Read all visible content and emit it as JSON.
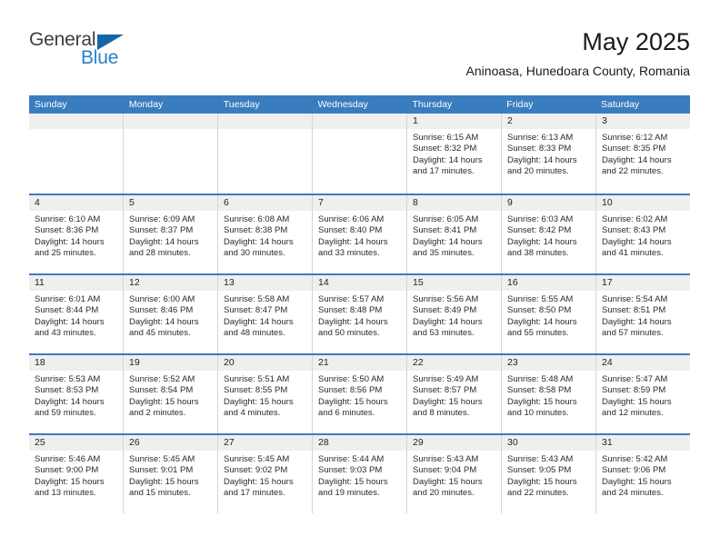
{
  "brand": {
    "name_top": "General",
    "name_bottom": "Blue",
    "triangle_icon": "blue-triangle-icon",
    "color_dark": "#3d3d3d",
    "color_blue": "#2a7fc9"
  },
  "header": {
    "title": "May 2025",
    "subtitle": "Aninoasa, Hunedoara County, Romania"
  },
  "colors": {
    "header_row_bg": "#3a7dbf",
    "header_row_text": "#ffffff",
    "daynum_bg": "#efefef",
    "cell_border": "#d5d5d5",
    "week_divider": "#3a7dbf"
  },
  "weekdays": [
    "Sunday",
    "Monday",
    "Tuesday",
    "Wednesday",
    "Thursday",
    "Friday",
    "Saturday"
  ],
  "weeks": [
    [
      {
        "day": "",
        "empty": true,
        "sunrise": "",
        "sunset": "",
        "daylight1": "",
        "daylight2": ""
      },
      {
        "day": "",
        "empty": true,
        "sunrise": "",
        "sunset": "",
        "daylight1": "",
        "daylight2": ""
      },
      {
        "day": "",
        "empty": true,
        "sunrise": "",
        "sunset": "",
        "daylight1": "",
        "daylight2": ""
      },
      {
        "day": "",
        "empty": true,
        "sunrise": "",
        "sunset": "",
        "daylight1": "",
        "daylight2": ""
      },
      {
        "day": "1",
        "empty": false,
        "sunrise": "Sunrise: 6:15 AM",
        "sunset": "Sunset: 8:32 PM",
        "daylight1": "Daylight: 14 hours",
        "daylight2": "and 17 minutes."
      },
      {
        "day": "2",
        "empty": false,
        "sunrise": "Sunrise: 6:13 AM",
        "sunset": "Sunset: 8:33 PM",
        "daylight1": "Daylight: 14 hours",
        "daylight2": "and 20 minutes."
      },
      {
        "day": "3",
        "empty": false,
        "sunrise": "Sunrise: 6:12 AM",
        "sunset": "Sunset: 8:35 PM",
        "daylight1": "Daylight: 14 hours",
        "daylight2": "and 22 minutes."
      }
    ],
    [
      {
        "day": "4",
        "empty": false,
        "sunrise": "Sunrise: 6:10 AM",
        "sunset": "Sunset: 8:36 PM",
        "daylight1": "Daylight: 14 hours",
        "daylight2": "and 25 minutes."
      },
      {
        "day": "5",
        "empty": false,
        "sunrise": "Sunrise: 6:09 AM",
        "sunset": "Sunset: 8:37 PM",
        "daylight1": "Daylight: 14 hours",
        "daylight2": "and 28 minutes."
      },
      {
        "day": "6",
        "empty": false,
        "sunrise": "Sunrise: 6:08 AM",
        "sunset": "Sunset: 8:38 PM",
        "daylight1": "Daylight: 14 hours",
        "daylight2": "and 30 minutes."
      },
      {
        "day": "7",
        "empty": false,
        "sunrise": "Sunrise: 6:06 AM",
        "sunset": "Sunset: 8:40 PM",
        "daylight1": "Daylight: 14 hours",
        "daylight2": "and 33 minutes."
      },
      {
        "day": "8",
        "empty": false,
        "sunrise": "Sunrise: 6:05 AM",
        "sunset": "Sunset: 8:41 PM",
        "daylight1": "Daylight: 14 hours",
        "daylight2": "and 35 minutes."
      },
      {
        "day": "9",
        "empty": false,
        "sunrise": "Sunrise: 6:03 AM",
        "sunset": "Sunset: 8:42 PM",
        "daylight1": "Daylight: 14 hours",
        "daylight2": "and 38 minutes."
      },
      {
        "day": "10",
        "empty": false,
        "sunrise": "Sunrise: 6:02 AM",
        "sunset": "Sunset: 8:43 PM",
        "daylight1": "Daylight: 14 hours",
        "daylight2": "and 41 minutes."
      }
    ],
    [
      {
        "day": "11",
        "empty": false,
        "sunrise": "Sunrise: 6:01 AM",
        "sunset": "Sunset: 8:44 PM",
        "daylight1": "Daylight: 14 hours",
        "daylight2": "and 43 minutes."
      },
      {
        "day": "12",
        "empty": false,
        "sunrise": "Sunrise: 6:00 AM",
        "sunset": "Sunset: 8:46 PM",
        "daylight1": "Daylight: 14 hours",
        "daylight2": "and 45 minutes."
      },
      {
        "day": "13",
        "empty": false,
        "sunrise": "Sunrise: 5:58 AM",
        "sunset": "Sunset: 8:47 PM",
        "daylight1": "Daylight: 14 hours",
        "daylight2": "and 48 minutes."
      },
      {
        "day": "14",
        "empty": false,
        "sunrise": "Sunrise: 5:57 AM",
        "sunset": "Sunset: 8:48 PM",
        "daylight1": "Daylight: 14 hours",
        "daylight2": "and 50 minutes."
      },
      {
        "day": "15",
        "empty": false,
        "sunrise": "Sunrise: 5:56 AM",
        "sunset": "Sunset: 8:49 PM",
        "daylight1": "Daylight: 14 hours",
        "daylight2": "and 53 minutes."
      },
      {
        "day": "16",
        "empty": false,
        "sunrise": "Sunrise: 5:55 AM",
        "sunset": "Sunset: 8:50 PM",
        "daylight1": "Daylight: 14 hours",
        "daylight2": "and 55 minutes."
      },
      {
        "day": "17",
        "empty": false,
        "sunrise": "Sunrise: 5:54 AM",
        "sunset": "Sunset: 8:51 PM",
        "daylight1": "Daylight: 14 hours",
        "daylight2": "and 57 minutes."
      }
    ],
    [
      {
        "day": "18",
        "empty": false,
        "sunrise": "Sunrise: 5:53 AM",
        "sunset": "Sunset: 8:53 PM",
        "daylight1": "Daylight: 14 hours",
        "daylight2": "and 59 minutes."
      },
      {
        "day": "19",
        "empty": false,
        "sunrise": "Sunrise: 5:52 AM",
        "sunset": "Sunset: 8:54 PM",
        "daylight1": "Daylight: 15 hours",
        "daylight2": "and 2 minutes."
      },
      {
        "day": "20",
        "empty": false,
        "sunrise": "Sunrise: 5:51 AM",
        "sunset": "Sunset: 8:55 PM",
        "daylight1": "Daylight: 15 hours",
        "daylight2": "and 4 minutes."
      },
      {
        "day": "21",
        "empty": false,
        "sunrise": "Sunrise: 5:50 AM",
        "sunset": "Sunset: 8:56 PM",
        "daylight1": "Daylight: 15 hours",
        "daylight2": "and 6 minutes."
      },
      {
        "day": "22",
        "empty": false,
        "sunrise": "Sunrise: 5:49 AM",
        "sunset": "Sunset: 8:57 PM",
        "daylight1": "Daylight: 15 hours",
        "daylight2": "and 8 minutes."
      },
      {
        "day": "23",
        "empty": false,
        "sunrise": "Sunrise: 5:48 AM",
        "sunset": "Sunset: 8:58 PM",
        "daylight1": "Daylight: 15 hours",
        "daylight2": "and 10 minutes."
      },
      {
        "day": "24",
        "empty": false,
        "sunrise": "Sunrise: 5:47 AM",
        "sunset": "Sunset: 8:59 PM",
        "daylight1": "Daylight: 15 hours",
        "daylight2": "and 12 minutes."
      }
    ],
    [
      {
        "day": "25",
        "empty": false,
        "sunrise": "Sunrise: 5:46 AM",
        "sunset": "Sunset: 9:00 PM",
        "daylight1": "Daylight: 15 hours",
        "daylight2": "and 13 minutes."
      },
      {
        "day": "26",
        "empty": false,
        "sunrise": "Sunrise: 5:45 AM",
        "sunset": "Sunset: 9:01 PM",
        "daylight1": "Daylight: 15 hours",
        "daylight2": "and 15 minutes."
      },
      {
        "day": "27",
        "empty": false,
        "sunrise": "Sunrise: 5:45 AM",
        "sunset": "Sunset: 9:02 PM",
        "daylight1": "Daylight: 15 hours",
        "daylight2": "and 17 minutes."
      },
      {
        "day": "28",
        "empty": false,
        "sunrise": "Sunrise: 5:44 AM",
        "sunset": "Sunset: 9:03 PM",
        "daylight1": "Daylight: 15 hours",
        "daylight2": "and 19 minutes."
      },
      {
        "day": "29",
        "empty": false,
        "sunrise": "Sunrise: 5:43 AM",
        "sunset": "Sunset: 9:04 PM",
        "daylight1": "Daylight: 15 hours",
        "daylight2": "and 20 minutes."
      },
      {
        "day": "30",
        "empty": false,
        "sunrise": "Sunrise: 5:43 AM",
        "sunset": "Sunset: 9:05 PM",
        "daylight1": "Daylight: 15 hours",
        "daylight2": "and 22 minutes."
      },
      {
        "day": "31",
        "empty": false,
        "sunrise": "Sunrise: 5:42 AM",
        "sunset": "Sunset: 9:06 PM",
        "daylight1": "Daylight: 15 hours",
        "daylight2": "and 24 minutes."
      }
    ]
  ]
}
